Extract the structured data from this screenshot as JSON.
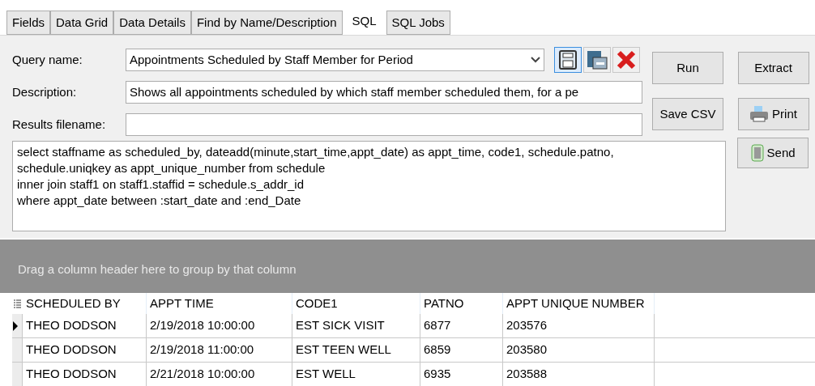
{
  "tabs": [
    {
      "label": "Fields",
      "selected": false
    },
    {
      "label": "Data Grid",
      "selected": false
    },
    {
      "label": "Data Details",
      "selected": false
    },
    {
      "label": "Find by Name/Description",
      "selected": false
    },
    {
      "label": "SQL",
      "selected": true
    },
    {
      "label": "SQL Jobs",
      "selected": false
    }
  ],
  "query_name": {
    "label": "Query name:",
    "value": "Appointments Scheduled by Staff Member for Period"
  },
  "description": {
    "label": "Description:",
    "value": "Shows all appointments scheduled by which staff member scheduled them, for a pe"
  },
  "results_filename": {
    "label": "Results filename:"
  },
  "buttons": {
    "run": "Run",
    "extract": "Extract",
    "save_csv": "Save CSV",
    "print": "Print",
    "send": "Send"
  },
  "sql": [
    "select staffname as scheduled_by, dateadd(minute,start_time,appt_date) as appt_time, code1, schedule.patno,",
    "schedule.uniqkey as appt_unique_number from schedule",
    "inner join staff1 on staff1.staffid = schedule.s_addr_id",
    "where appt_date between :start_date and :end_Date"
  ],
  "group_panel": {
    "hint": "Drag a column header here to group by that column"
  },
  "table": {
    "columns": [
      "SCHEDULED BY",
      "APPT TIME",
      "CODE1",
      "PATNO",
      "APPT UNIQUE NUMBER"
    ],
    "rows": [
      {
        "selected": true,
        "cells": [
          "THEO DODSON",
          "2/19/2018 10:00:00",
          "EST SICK VISIT",
          "6877",
          "203576"
        ]
      },
      {
        "selected": false,
        "cells": [
          "THEO DODSON",
          "2/19/2018 11:00:00",
          "EST TEEN WELL",
          "6859",
          "203580"
        ]
      },
      {
        "selected": false,
        "cells": [
          "THEO DODSON",
          "2/21/2018 10:00:00",
          "EST WELL",
          "6935",
          "203588"
        ]
      }
    ]
  }
}
